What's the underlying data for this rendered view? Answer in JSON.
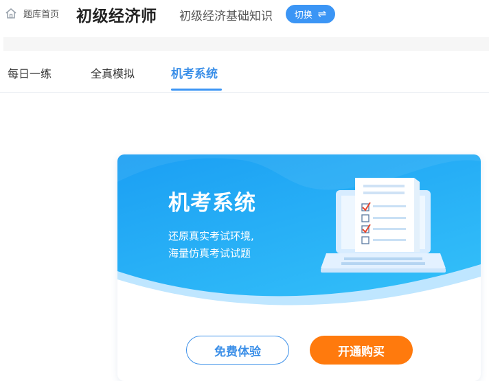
{
  "header": {
    "home_label": "题库首页",
    "exam_title": "初级经济师",
    "subject": "初级经济基础知识",
    "switch_label": "切换",
    "switch_icon": "⇌"
  },
  "tabs": [
    {
      "label": "每日一练",
      "active": false
    },
    {
      "label": "全真模拟",
      "active": false
    },
    {
      "label": "机考系统",
      "active": true
    }
  ],
  "card": {
    "title": "机考系统",
    "desc_line1": "还原真实考试环境,",
    "desc_line2": "海量仿真考试试题",
    "trial_button": "免费体验",
    "buy_button": "开通购买"
  },
  "colors": {
    "accent": "#3b95f5",
    "banner_top": "#1fa5f5",
    "banner_bottom": "#3ec4ff",
    "buy": "#ff7a0d"
  }
}
